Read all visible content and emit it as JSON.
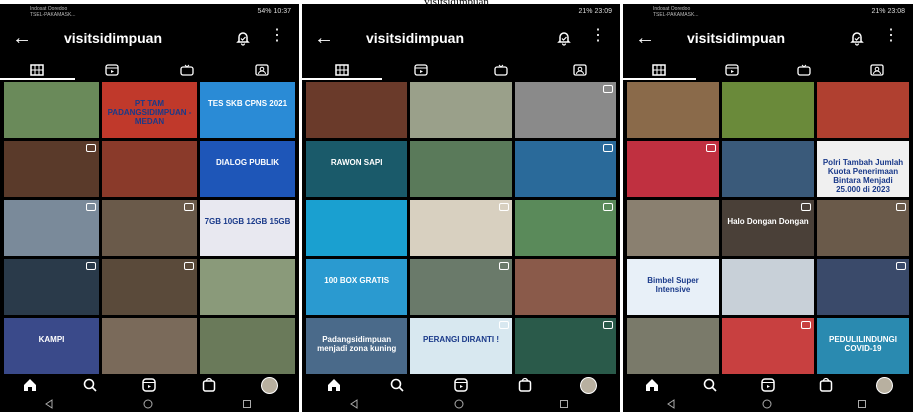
{
  "caption": "visitsidimpuan",
  "phones": [
    {
      "status": {
        "carrier": "Indosat Ooredoo",
        "carrier2": "TSEL-PAKAMASK...",
        "right": "54% 10:37"
      },
      "header": {
        "title": "visitsidimpuan"
      },
      "tiles": [
        {
          "bg": "#6a8a5a",
          "text": "",
          "reel": false
        },
        {
          "bg": "#c0392b",
          "text": "PT TAM PADANGSIDIMPUAN - MEDAN",
          "reel": false
        },
        {
          "bg": "#2a8bd6",
          "text": "TES SKB CPNS 2021",
          "reel": false
        },
        {
          "bg": "#5a3a2a",
          "text": "",
          "reel": true
        },
        {
          "bg": "#8a3a2a",
          "text": "",
          "reel": false
        },
        {
          "bg": "#1e56b8",
          "text": "DIALOG PUBLIK",
          "reel": false
        },
        {
          "bg": "#7a8a9a",
          "text": "",
          "reel": true
        },
        {
          "bg": "#6a5a4a",
          "text": "",
          "reel": true
        },
        {
          "bg": "#e8e8f0",
          "text": "7GB 10GB 12GB 15GB",
          "reel": false
        },
        {
          "bg": "#2a3a4a",
          "text": "",
          "reel": true
        },
        {
          "bg": "#5a4a3a",
          "text": "",
          "reel": true
        },
        {
          "bg": "#8a9a7a",
          "text": "",
          "reel": false
        },
        {
          "bg": "#3a4a8a",
          "text": "KAMPI",
          "reel": false
        },
        {
          "bg": "#7a6a5a",
          "text": "",
          "reel": false
        },
        {
          "bg": "#6a7a5a",
          "text": "",
          "reel": false
        }
      ]
    },
    {
      "status": {
        "carrier": "",
        "carrier2": "",
        "right": "21% 23:09"
      },
      "header": {
        "title": "visitsidimpuan"
      },
      "tiles": [
        {
          "bg": "#6a3a2a",
          "text": "",
          "reel": false
        },
        {
          "bg": "#9aa08a",
          "text": "",
          "reel": false
        },
        {
          "bg": "#8a8a8a",
          "text": "",
          "reel": true
        },
        {
          "bg": "#1a5a6a",
          "text": "RAWON SAPI",
          "reel": false
        },
        {
          "bg": "#5a7a5a",
          "text": "",
          "reel": false
        },
        {
          "bg": "#2a6a9a",
          "text": "",
          "reel": true
        },
        {
          "bg": "#1aa0d0",
          "text": "",
          "reel": false
        },
        {
          "bg": "#d8d0c0",
          "text": "",
          "reel": true
        },
        {
          "bg": "#5a8a5a",
          "text": "",
          "reel": true
        },
        {
          "bg": "#2a9ad0",
          "text": "100 BOX GRATIS",
          "reel": false
        },
        {
          "bg": "#6a7a6a",
          "text": "",
          "reel": true
        },
        {
          "bg": "#8a5a4a",
          "text": "",
          "reel": false
        },
        {
          "bg": "#4a6a8a",
          "text": "Padangsidimpuan menjadi zona kuning",
          "reel": false
        },
        {
          "bg": "#d8e8f0",
          "text": "PERANGI DIRANTI !",
          "reel": true
        },
        {
          "bg": "#2a5a4a",
          "text": "",
          "reel": true
        }
      ]
    },
    {
      "status": {
        "carrier": "Indosat Ooredoo",
        "carrier2": "TSEL-PAKAMASK...",
        "right": "21% 23:08"
      },
      "header": {
        "title": "visitsidimpuan"
      },
      "tiles": [
        {
          "bg": "#8a6a4a",
          "text": "",
          "reel": false
        },
        {
          "bg": "#6a8a3a",
          "text": "",
          "reel": false
        },
        {
          "bg": "#b04030",
          "text": "",
          "reel": false
        },
        {
          "bg": "#c03040",
          "text": "",
          "reel": true
        },
        {
          "bg": "#3a5a7a",
          "text": "",
          "reel": false
        },
        {
          "bg": "#f0f0f0",
          "text": "Polri Tambah Jumlah Kuota Penerimaan Bintara Menjadi 25.000 di 2023",
          "reel": false
        },
        {
          "bg": "#8a8070",
          "text": "",
          "reel": false
        },
        {
          "bg": "#4a4038",
          "text": "Halo Dongan Dongan",
          "reel": true
        },
        {
          "bg": "#6a5a4a",
          "text": "",
          "reel": true
        },
        {
          "bg": "#e8f0f8",
          "text": "Bimbel Super Intensive",
          "reel": false
        },
        {
          "bg": "#c8d0d8",
          "text": "",
          "reel": false
        },
        {
          "bg": "#3a4a6a",
          "text": "",
          "reel": true
        },
        {
          "bg": "#7a7a6a",
          "text": "",
          "reel": false
        },
        {
          "bg": "#c84040",
          "text": "",
          "reel": true
        },
        {
          "bg": "#2a8ab0",
          "text": "PEDULILINDUNGI COVID-19",
          "reel": false
        }
      ]
    }
  ]
}
